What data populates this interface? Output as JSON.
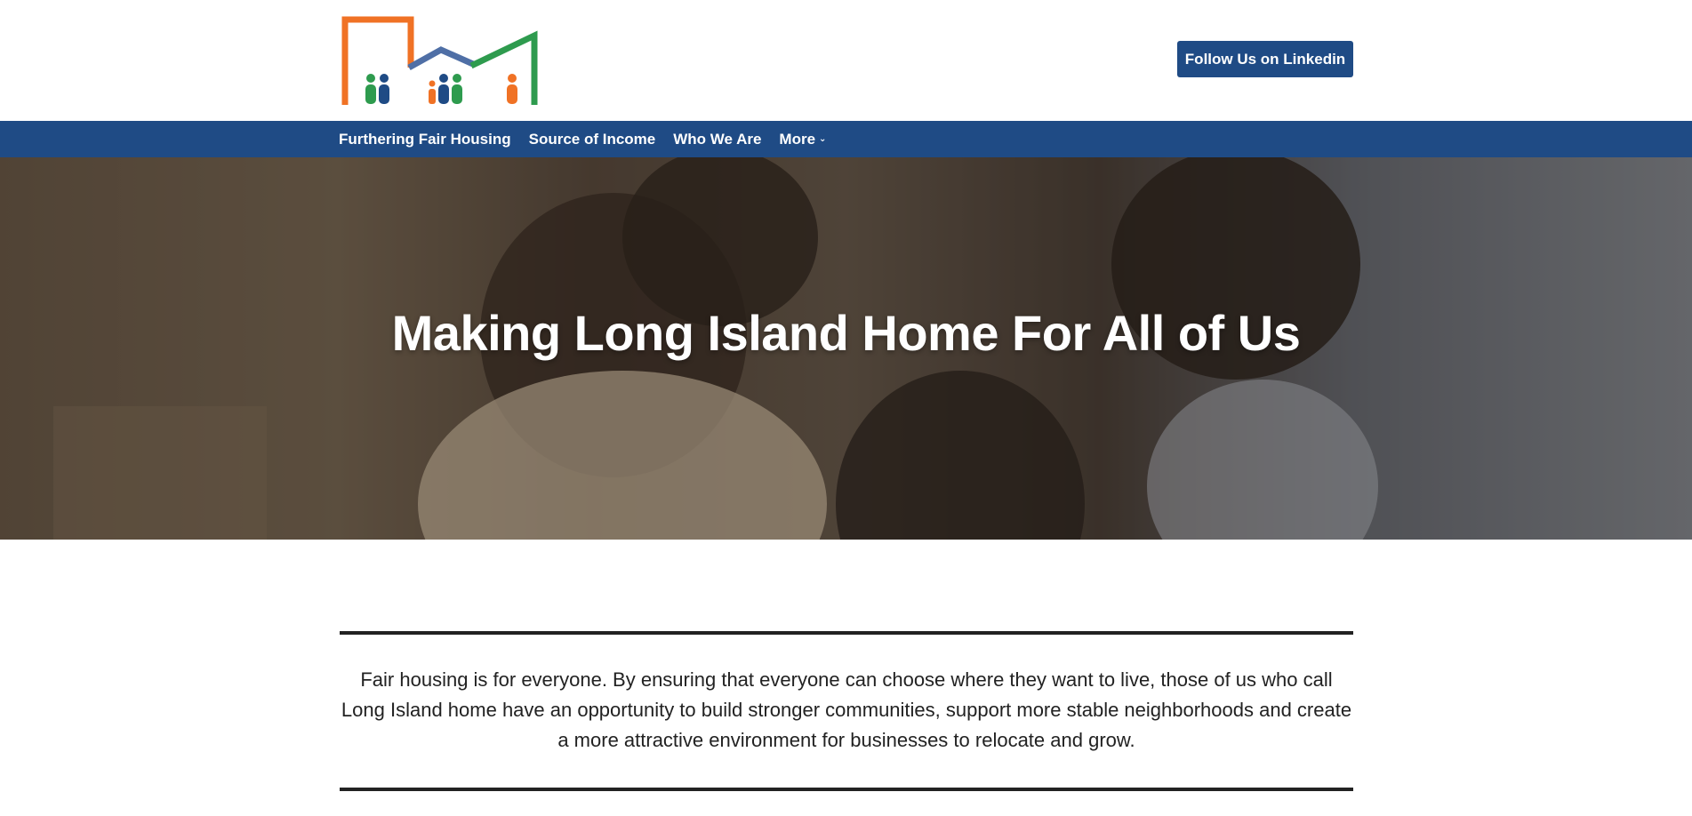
{
  "header": {
    "linkedin_button": "Follow Us on Linkedin",
    "logo_icon": "houses-with-families-logo"
  },
  "nav": {
    "items": [
      {
        "label": "Furthering Fair Housing"
      },
      {
        "label": "Source of Income"
      },
      {
        "label": "Who We Are"
      },
      {
        "label": "More"
      }
    ],
    "more_icon": "chevron-down-icon"
  },
  "hero": {
    "title": "Making Long Island Home For All of Us"
  },
  "intro": {
    "text": "Fair housing is for everyone. By ensuring that everyone can choose where they want to live, those of us who call Long Island home have an opportunity to build stronger communities, support more stable neighborhoods and create a more attractive environment for businesses to relocate and grow."
  },
  "colors": {
    "brand_blue": "#1f4b85",
    "logo_orange": "#f07225",
    "logo_green": "#2e9b4e",
    "logo_blue": "#4f6fa6"
  }
}
